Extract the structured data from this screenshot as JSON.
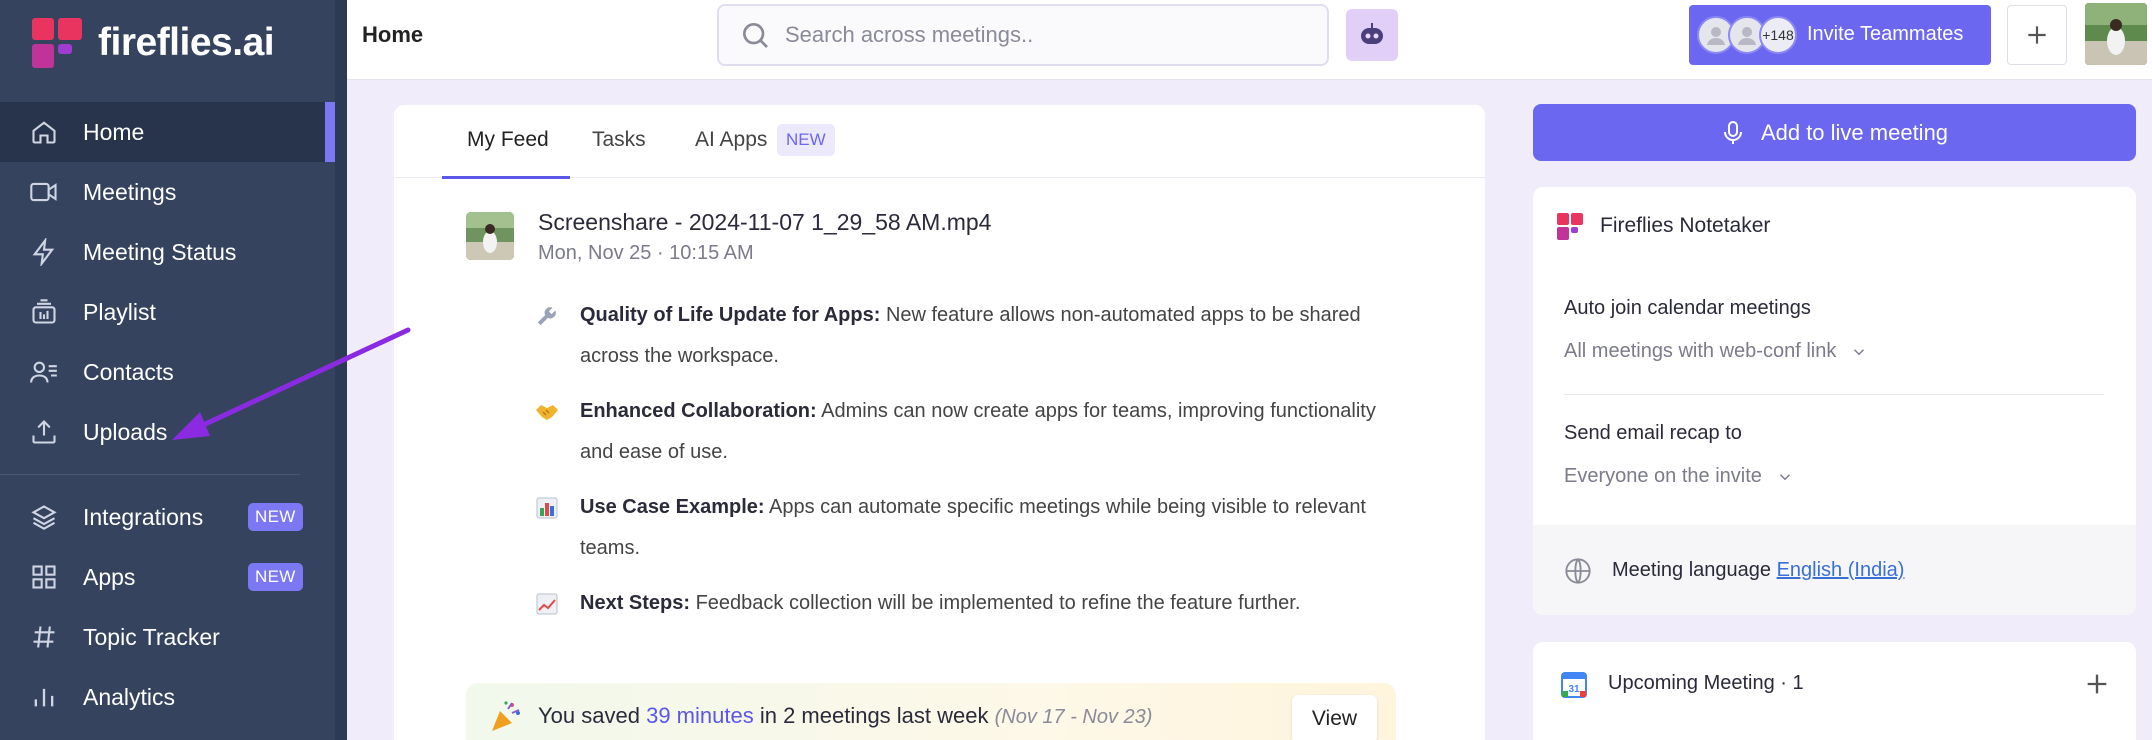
{
  "brand": {
    "name": "fireflies.ai",
    "logo_colors": [
      "#e8345f",
      "#a03cd0"
    ]
  },
  "sidebar": {
    "items": [
      {
        "label": "Home",
        "icon": "home-icon",
        "active": true
      },
      {
        "label": "Meetings",
        "icon": "video-icon"
      },
      {
        "label": "Meeting Status",
        "icon": "lightning-icon"
      },
      {
        "label": "Playlist",
        "icon": "playlist-icon"
      },
      {
        "label": "Contacts",
        "icon": "contacts-icon"
      },
      {
        "label": "Uploads",
        "icon": "upload-icon"
      },
      {
        "label": "Integrations",
        "icon": "layers-icon",
        "badge": "NEW"
      },
      {
        "label": "Apps",
        "icon": "grid-icon",
        "badge": "NEW"
      },
      {
        "label": "Topic Tracker",
        "icon": "hashtag-icon"
      },
      {
        "label": "Analytics",
        "icon": "bar-chart-icon"
      }
    ]
  },
  "topbar": {
    "title": "Home",
    "search_placeholder": "Search across meetings..",
    "invite": {
      "count": "+148",
      "label": "Invite Teammates"
    }
  },
  "feed": {
    "tabs": [
      {
        "label": "My Feed",
        "active": true
      },
      {
        "label": "Tasks"
      },
      {
        "label": "AI Apps",
        "badge": "NEW"
      }
    ],
    "post": {
      "title": "Screenshare - 2024-11-07 1_29_58 AM.mp4",
      "date": "Mon, Nov 25 · 10:15 AM",
      "bullets": [
        {
          "emoji": "🔧",
          "bold": "Quality of Life Update for Apps:",
          "text": "New feature allows non-automated apps to be shared across the workspace."
        },
        {
          "emoji": "🤝",
          "bold": "Enhanced Collaboration:",
          "text": "Admins can now create apps for teams, improving functionality and ease of use."
        },
        {
          "emoji": "📊",
          "bold": "Use Case Example:",
          "text": "Apps can automate specific meetings while being visible to relevant teams."
        },
        {
          "emoji": "📈",
          "bold": "Next Steps:",
          "text": "Feedback collection will be implemented to refine the feature further."
        }
      ]
    },
    "saved": {
      "prefix": "You saved",
      "minutes": "39 minutes",
      "middle": "in 2 meetings last week",
      "range": "(Nov 17 - Nov 23)",
      "button": "View"
    }
  },
  "right": {
    "live_button": "Add to live meeting",
    "notetaker": {
      "title": "Fireflies Notetaker",
      "auto_join_label": "Auto join calendar meetings",
      "auto_join_value": "All meetings with web-conf link",
      "email_label": "Send email recap to",
      "email_value": "Everyone on the invite",
      "language_label": "Meeting language",
      "language_value": "English (India)"
    },
    "upcoming": {
      "title": "Upcoming Meeting · 1"
    }
  },
  "colors": {
    "accent": "#6b67f0",
    "sidebar_bg": "#35435f",
    "annotation_arrow": "#8a2be2"
  }
}
